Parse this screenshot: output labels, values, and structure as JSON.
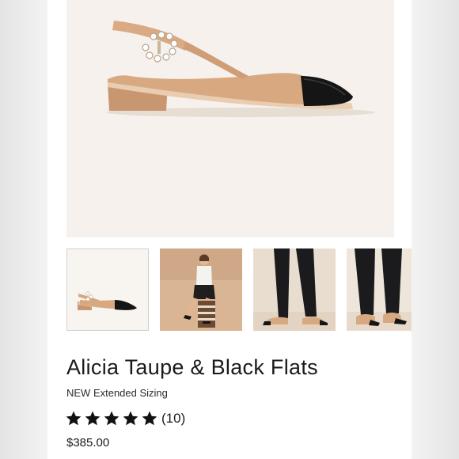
{
  "product": {
    "title": "Alicia Taupe & Black Flats",
    "subtitle": "NEW Extended Sizing",
    "price": "$385.00",
    "rating": {
      "stars": 5,
      "max_stars": 5,
      "review_count": "(10)"
    }
  },
  "gallery": {
    "thumbnails": [
      {
        "label": "thumbnail-shoe-product",
        "selected": true
      },
      {
        "label": "thumbnail-model-seated",
        "selected": false
      },
      {
        "label": "thumbnail-model-legs-side",
        "selected": false
      },
      {
        "label": "thumbnail-model-legs-front",
        "selected": false
      }
    ]
  },
  "colors": {
    "taupe": "#d8a981",
    "cap": "#151515",
    "hero_bg": "#f6f1ec",
    "star": "#111111"
  },
  "icons": {
    "star": "star-icon"
  }
}
